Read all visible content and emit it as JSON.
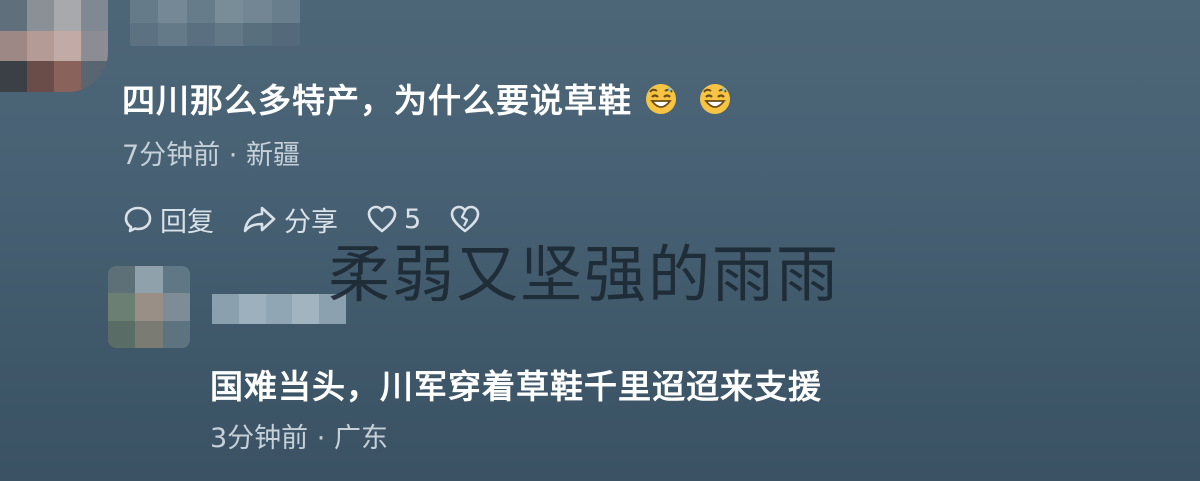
{
  "comment": {
    "text": "四川那么多特产，为什么要说草鞋",
    "emojis": [
      "grinning-sweat-emoji",
      "grinning-sweat-emoji"
    ],
    "time": "7分钟前",
    "separator": "·",
    "location": "新疆"
  },
  "actions": {
    "reply_label": "回复",
    "share_label": "分享",
    "like_count": "5"
  },
  "reply": {
    "text": "国难当头，川军穿着草鞋千里迢迢来支援",
    "time": "3分钟前",
    "separator": "·",
    "location": "广东"
  },
  "watermark": "柔弱又坚强的雨雨",
  "colors": {
    "background": "#486174",
    "text": "#ffffff",
    "meta": "#c5d0d9",
    "watermark": "#1b2731"
  }
}
